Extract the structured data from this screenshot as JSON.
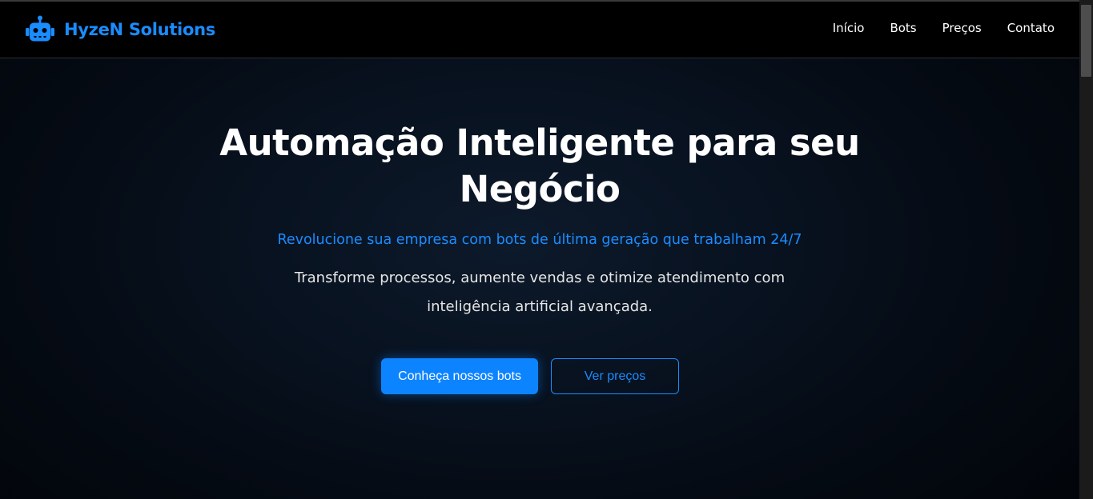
{
  "brand": {
    "name": "HyzeN Solutions",
    "icon": "robot-icon",
    "color": "#1a8cff"
  },
  "nav": {
    "items": [
      {
        "label": "Início"
      },
      {
        "label": "Bots"
      },
      {
        "label": "Preços"
      },
      {
        "label": "Contato"
      }
    ]
  },
  "hero": {
    "title": "Automação Inteligente para seu Negócio",
    "subtitle": "Revolucione sua empresa com bots de última geração que trabalham 24/7",
    "description": "Transforme processos, aumente vendas e otimize atendimento com inteligência artificial avançada.",
    "primary_cta": "Conheça nossos bots",
    "secondary_cta": "Ver preços"
  },
  "colors": {
    "accent": "#0d84ff",
    "background": "#050b14"
  }
}
